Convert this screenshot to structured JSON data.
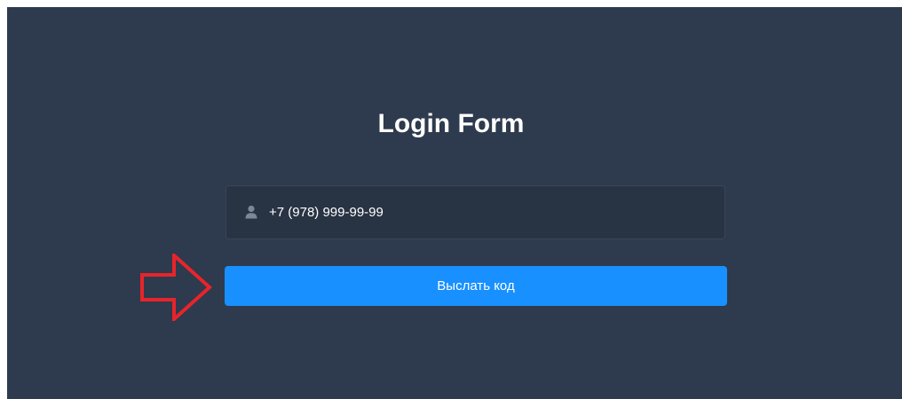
{
  "form": {
    "title": "Login Form",
    "phone_value": "+7 (978) 999-99-99",
    "send_button_label": "Выслать код"
  },
  "icons": {
    "phone_field_icon": "user-icon",
    "annotation": "right-arrow-icon"
  },
  "colors": {
    "background": "#2e3a4d",
    "input_background": "#283343",
    "button": "#1890ff",
    "annotation_arrow": "#e8242b",
    "text": "#ffffff"
  }
}
